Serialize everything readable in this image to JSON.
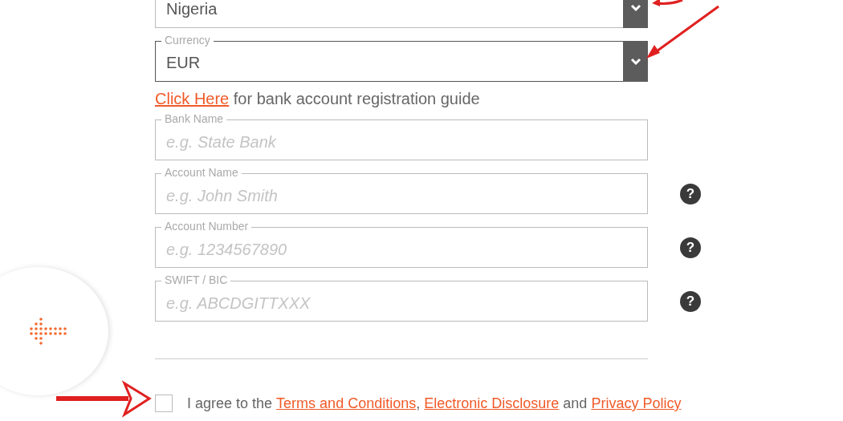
{
  "fields": [
    {
      "kind": "select",
      "value": "Nigeria",
      "focused": false
    },
    {
      "kind": "select",
      "label": "Currency",
      "value": "EUR",
      "focused": true
    }
  ],
  "guide": {
    "link": "Click Here",
    "text": "for bank account registration guide"
  },
  "bank_fields": [
    {
      "kind": "text",
      "label": "Bank Name",
      "placeholder": "e.g. State Bank",
      "help": false
    },
    {
      "kind": "text",
      "label": "Account Name",
      "placeholder": "e.g. John Smith",
      "help": true
    },
    {
      "kind": "text",
      "label": "Account Number",
      "placeholder": "e.g. 1234567890",
      "help": true
    },
    {
      "kind": "text",
      "label": "SWIFT / BIC",
      "placeholder": "e.g. ABCDGITTXXX",
      "help": true
    }
  ],
  "help_icon": "?",
  "agreement": {
    "checked": false,
    "parts": [
      {
        "kind": "text",
        "text": "I agree to the"
      },
      {
        "kind": "link",
        "text": "Terms and Conditions"
      },
      {
        "kind": "punct",
        "text": ","
      },
      {
        "kind": "link",
        "text": "Electronic Disclosure"
      },
      {
        "kind": "text",
        "text": "and"
      },
      {
        "kind": "link",
        "text": "Privacy Policy"
      }
    ]
  }
}
